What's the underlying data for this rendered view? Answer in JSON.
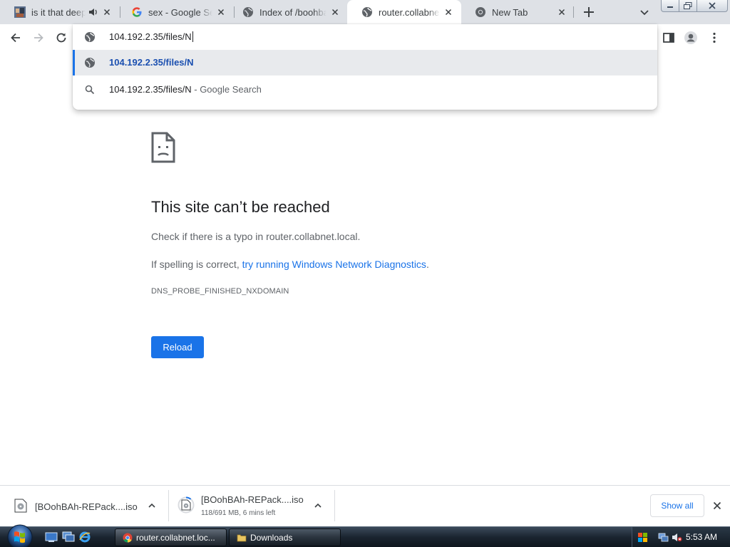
{
  "tabs": [
    {
      "title": "is it that deep",
      "audio": true,
      "active": false
    },
    {
      "title": "sex - Google Search",
      "active": false
    },
    {
      "title": "Index of /boohbah",
      "active": false
    },
    {
      "title": "router.collabnet.local",
      "active": true
    },
    {
      "title": "New Tab",
      "active": false
    }
  ],
  "omnibox": {
    "value": "104.192.2.35/files/N",
    "suggestions": [
      {
        "text": "104.192.2.35/files/N",
        "icon": "globe-icon"
      },
      {
        "text": "104.192.2.35/files/N",
        "suffix": " - Google Search",
        "icon": "search-icon"
      }
    ]
  },
  "error": {
    "title": "This site can’t be reached",
    "line1": "Check if there is a typo in router.collabnet.local.",
    "line2_prefix": "If spelling is correct, ",
    "line2_link": "try running Windows Network Diagnostics",
    "line2_suffix": ".",
    "code": "DNS_PROBE_FINISHED_NXDOMAIN",
    "reload_label": "Reload"
  },
  "downloads": [
    {
      "name": "[BOohBAh-REPack....iso",
      "status": ""
    },
    {
      "name": "[BOohBAh-REPack....iso",
      "status": "118/691 MB, 6 mins left"
    }
  ],
  "shelf": {
    "show_all_label": "Show all"
  },
  "taskbar": {
    "buttons": [
      {
        "label": "router.collabnet.loc...",
        "icon": "chrome-icon",
        "active": true
      },
      {
        "label": "Downloads",
        "icon": "folder-icon",
        "active": false
      }
    ],
    "clock": "5:53 AM"
  },
  "colors": {
    "accent": "#1a73e8",
    "tabstrip": "#dee1e6",
    "text_secondary": "#5f6368"
  }
}
